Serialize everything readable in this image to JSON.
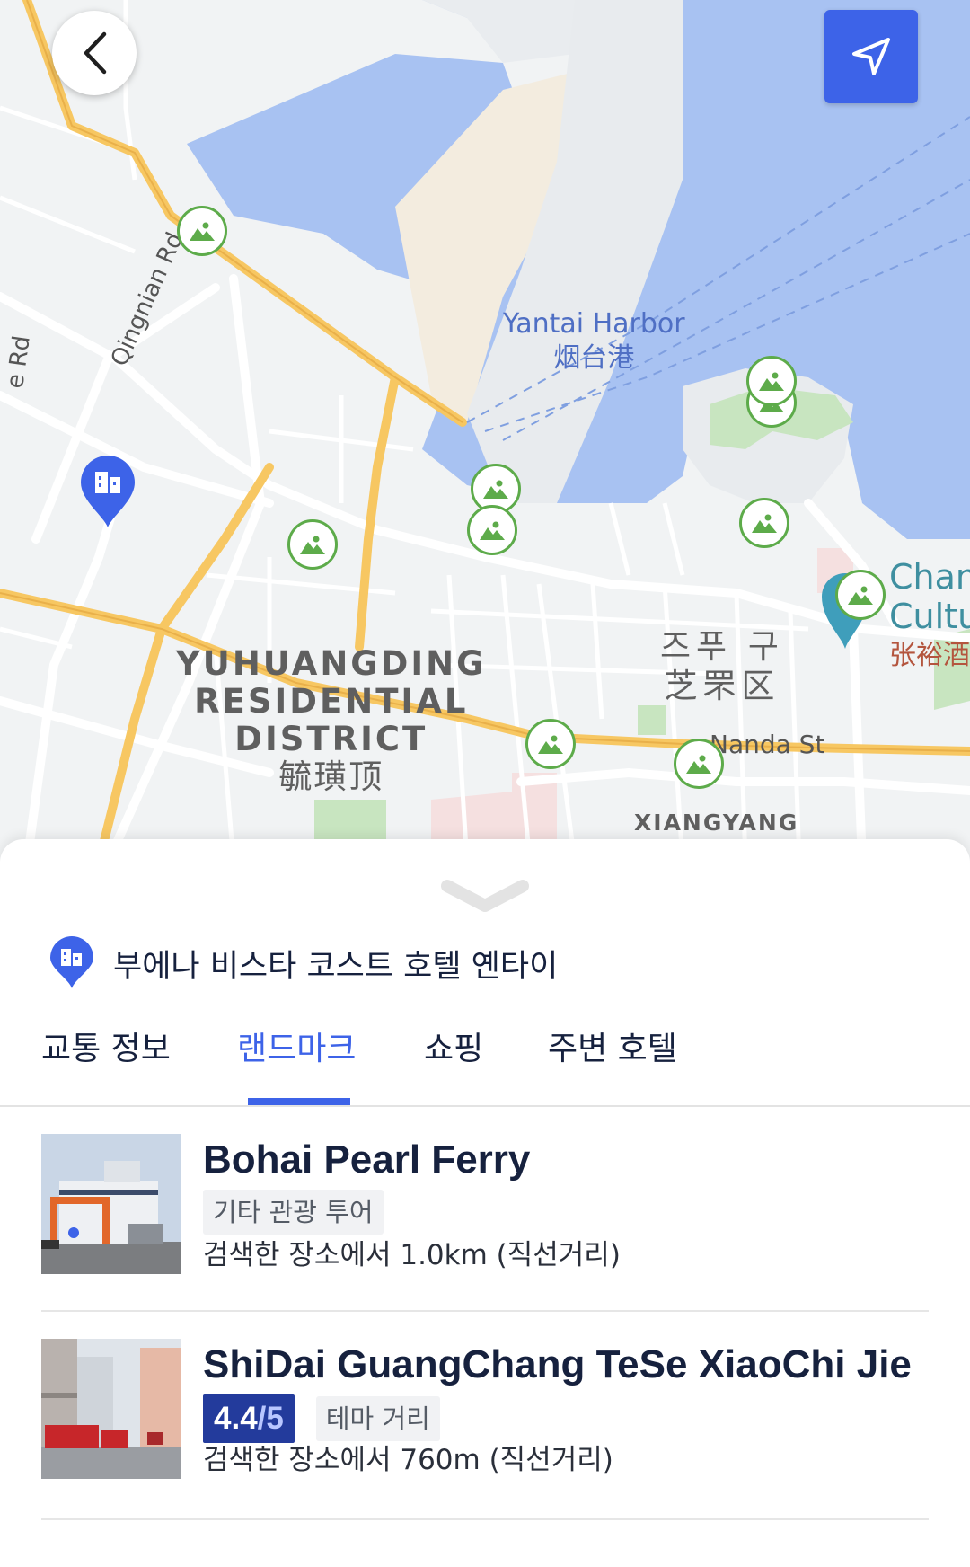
{
  "map": {
    "labels": {
      "harbor_en": "Yantai Harbor",
      "harbor_cn": "烟台港",
      "district_en_1": "YUHUANGDING",
      "district_en_2": "RESIDENTIAL",
      "district_en_3": "DISTRICT",
      "district_cn": "毓璜顶",
      "zhifu_ko": "즈푸 구",
      "zhifu_cn": "芝罘区",
      "nanda_st": "Nanda St",
      "xiangyang": "XIANGYANG",
      "qingnian_rd": "Qingnian Rd",
      "rd_fragment": "e Rd",
      "chan_1": "Chan",
      "chan_2": "Cultu",
      "chan_cn": "张裕酒"
    },
    "colors": {
      "water": "#a8c2f2",
      "land": "#f1f3f4",
      "road_major": "#f7c762",
      "park": "#c8e5c0",
      "poi": "#5dab4a"
    }
  },
  "buttons": {
    "back": "back",
    "my_location": "navigate"
  },
  "sheet": {
    "hotel_name": "부에나 비스타 코스트 호텔 옌타이",
    "tabs": [
      {
        "label": "교통 정보"
      },
      {
        "label": "랜드마크"
      },
      {
        "label": "쇼핑"
      },
      {
        "label": "주변 호텔"
      }
    ],
    "active_tab": "랜드마크",
    "items": [
      {
        "title": "Bohai Pearl Ferry",
        "tag": "기타 관광 투어",
        "distance": "검색한 장소에서 1.0km (직선거리)"
      },
      {
        "title": "ShiDai GuangChang TeSe XiaoChi Jie",
        "rating": "4.4",
        "rating_den": "/5",
        "tag": "테마 거리",
        "distance": "검색한 장소에서 760m (직선거리)"
      }
    ]
  },
  "accent_color": "#3d63e8"
}
